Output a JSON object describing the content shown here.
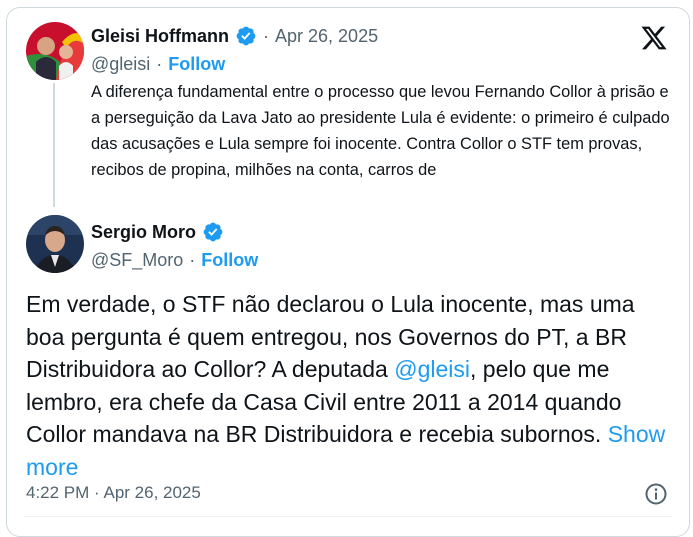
{
  "quoted": {
    "name": "Gleisi Hoffmann",
    "sep": "·",
    "date": "Apr 26, 2025",
    "handle": "@gleisi",
    "follow": "Follow",
    "text": "A diferença fundamental entre o processo que levou Fernando Collor à prisão e a perseguição da Lava Jato ao presidente Lula é evidente: o primeiro é culpado das acusações e Lula sempre foi inocente. Contra Collor o STF tem provas, recibos de propina, milhões na conta, carros de"
  },
  "reply": {
    "name": "Sergio Moro",
    "handle": "@SF_Moro",
    "sep": "·",
    "follow": "Follow",
    "text_before": "Em verdade, o STF não declarou o Lula inocente, mas uma boa pergunta é quem entregou, nos Governos do PT, a BR Distribuidora ao Collor? A deputada ",
    "mention": "@gleisi",
    "text_after": ", pelo que me lembro, era chefe da Casa Civil entre 2011 a 2014 quando Collor mandava na BR Distribuidora e recebia subornos. ",
    "show_more": "Show more",
    "timestamp": "4:22 PM · Apr 26, 2025"
  },
  "icons": {
    "platform": "x-logo-icon",
    "verified": "verified-badge-icon",
    "info": "info-icon"
  },
  "colors": {
    "accent": "#1d9bf0",
    "text": "#0f1419",
    "muted": "#536471",
    "border": "#cfd9de"
  }
}
